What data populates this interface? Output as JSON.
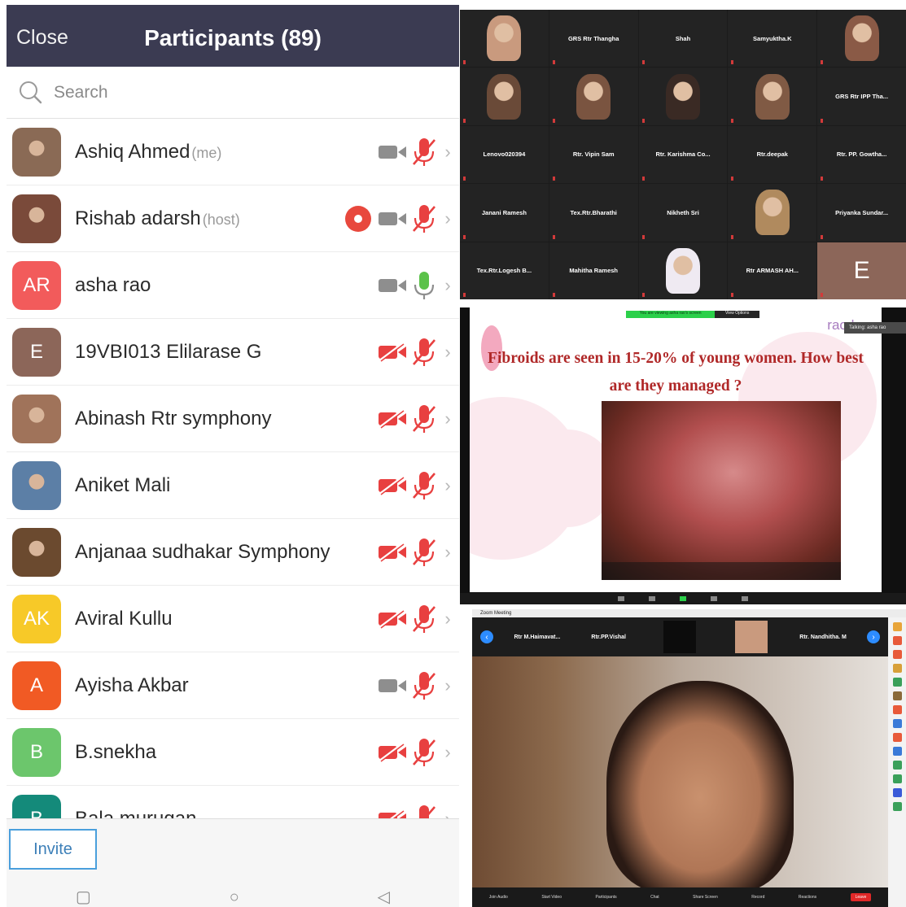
{
  "participants_panel": {
    "close_label": "Close",
    "title": "Participants (89)",
    "search_placeholder": "Search",
    "invite_label": "Invite",
    "participants": [
      {
        "name": "Ashiq Ahmed",
        "tag": "(me)",
        "initials": "",
        "avatar_color": "#8a6a55",
        "video": "on",
        "audio": "muted",
        "recording": false
      },
      {
        "name": "Rishab adarsh",
        "tag": "(host)",
        "initials": "",
        "avatar_color": "#7a4a3a",
        "video": "on",
        "audio": "muted",
        "recording": true
      },
      {
        "name": "asha rao",
        "tag": "",
        "initials": "AR",
        "avatar_color": "#f25b5b",
        "video": "on",
        "audio": "on",
        "recording": false
      },
      {
        "name": "19VBI013 Elilarase G",
        "tag": "",
        "initials": "E",
        "avatar_color": "#8c6659",
        "video": "off",
        "audio": "muted",
        "recording": false
      },
      {
        "name": "Abinash Rtr symphony",
        "tag": "",
        "initials": "",
        "avatar_color": "#a0735a",
        "video": "off",
        "audio": "muted",
        "recording": false
      },
      {
        "name": "Aniket Mali",
        "tag": "",
        "initials": "",
        "avatar_color": "#5c7fa6",
        "video": "off",
        "audio": "muted",
        "recording": false
      },
      {
        "name": "Anjanaa sudhakar Symphony",
        "tag": "",
        "initials": "",
        "avatar_color": "#6b4a2f",
        "video": "off",
        "audio": "muted",
        "recording": false
      },
      {
        "name": "Aviral Kullu",
        "tag": "",
        "initials": "AK",
        "avatar_color": "#f7c928",
        "video": "off",
        "audio": "muted",
        "recording": false
      },
      {
        "name": "Ayisha Akbar",
        "tag": "",
        "initials": "A",
        "avatar_color": "#f15a24",
        "video": "on",
        "audio": "muted",
        "recording": false
      },
      {
        "name": "B.snekha",
        "tag": "",
        "initials": "B",
        "avatar_color": "#6cc66c",
        "video": "off",
        "audio": "muted",
        "recording": false
      },
      {
        "name": "Bala murugan",
        "tag": "",
        "initials": "B",
        "avatar_color": "#148a7a",
        "video": "off",
        "audio": "muted",
        "recording": false
      }
    ]
  },
  "gallery": {
    "tiles": [
      {
        "label": "",
        "face": "#c99a7e"
      },
      {
        "label": "GRS Rtr Thangha",
        "face": ""
      },
      {
        "label": "Shah",
        "face": ""
      },
      {
        "label": "Samyuktha.K",
        "face": ""
      },
      {
        "label": "",
        "face": "#8a5a46"
      },
      {
        "label": "",
        "face": "#6a4a38"
      },
      {
        "label": "",
        "face": "#7a5440"
      },
      {
        "label": "",
        "face": "#3a2a24"
      },
      {
        "label": "",
        "face": "#805a44"
      },
      {
        "label": "GRS Rtr IPP Tha...",
        "face": ""
      },
      {
        "label": "Lenovo020394",
        "face": ""
      },
      {
        "label": "Rtr. Vipin Sam",
        "face": ""
      },
      {
        "label": "Rtr. Karishma Co...",
        "face": ""
      },
      {
        "label": "Rtr.deepak",
        "face": ""
      },
      {
        "label": "Rtr. PP. Gowtha...",
        "face": ""
      },
      {
        "label": "Janani Ramesh",
        "face": ""
      },
      {
        "label": "Tex.Rtr.Bharathi",
        "face": ""
      },
      {
        "label": "Nikheth Sri",
        "face": ""
      },
      {
        "label": "",
        "face": "#b08a5e"
      },
      {
        "label": "Priyanka Sundar...",
        "face": ""
      },
      {
        "label": "Tex.Rtr.Logesh B...",
        "face": ""
      },
      {
        "label": "Mahitha Ramesh",
        "face": ""
      },
      {
        "label": "",
        "face": "#efeaf2"
      },
      {
        "label": "Rtr ARMASH AH...",
        "face": ""
      },
      {
        "label": "E",
        "face": "#8c6659"
      }
    ]
  },
  "slide": {
    "title": "Fibroids are seen in 15-20% of young women. How best are they managed ?",
    "logo": "rao hos",
    "share_notice": "You are viewing asha rao's screen",
    "view_options": "View Options",
    "talking": "Talking: asha rao"
  },
  "speaker_view": {
    "window_title": "Zoom Meeting",
    "strip": [
      "Rtr M.Haimavat...",
      "Rtr.PP.Vishal",
      "",
      "",
      "Rtr. Nandhitha. M"
    ],
    "toolbar": [
      "Join Audio",
      "Start Video",
      "Participants",
      "Chat",
      "Share Screen",
      "Record",
      "Reactions"
    ],
    "leave_label": "Leave",
    "side_colors": [
      "#e8a53a",
      "#e85a3a",
      "#e85a3a",
      "#d8a03a",
      "#3aa05a",
      "#8a6a3a",
      "#e85a3a",
      "#3a7ad8",
      "#e85a3a",
      "#3a7ad8",
      "#3aa05a",
      "#3aa05a",
      "#3a5ad8",
      "#3aa05a"
    ]
  }
}
